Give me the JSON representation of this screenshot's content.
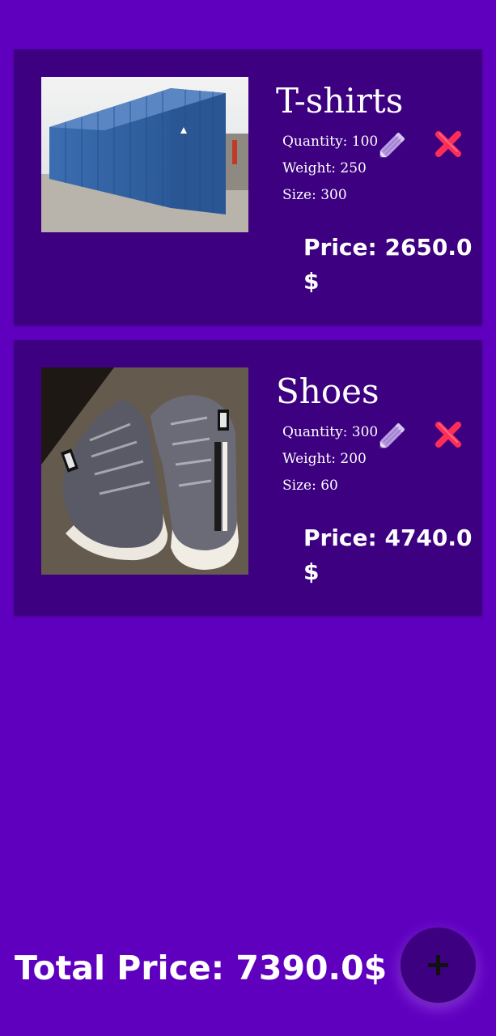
{
  "products": [
    {
      "name": "T-shirts",
      "quantity": "Quantity: 100",
      "weight": "Weight: 250",
      "size": "Size: 300",
      "price": "Price: 2650.0 $",
      "image": "shipping-container-photo"
    },
    {
      "name": "Shoes",
      "quantity": "Quantity: 300",
      "weight": "Weight: 200",
      "size": "Size: 60",
      "price": "Price: 4740.0 $",
      "image": "high-top-sneakers-photo"
    }
  ],
  "total_price": "Total Price: 7390.0$",
  "add_button": {
    "icon": "plus-icon"
  },
  "icons": {
    "edit": "pencil-icon",
    "delete": "cross-mark-icon"
  },
  "colors": {
    "background": "#5f00bf",
    "card": "#3c0080",
    "text": "#ffffff",
    "edit_icon": "#b79be0",
    "delete_icon": "#ff2d55"
  }
}
